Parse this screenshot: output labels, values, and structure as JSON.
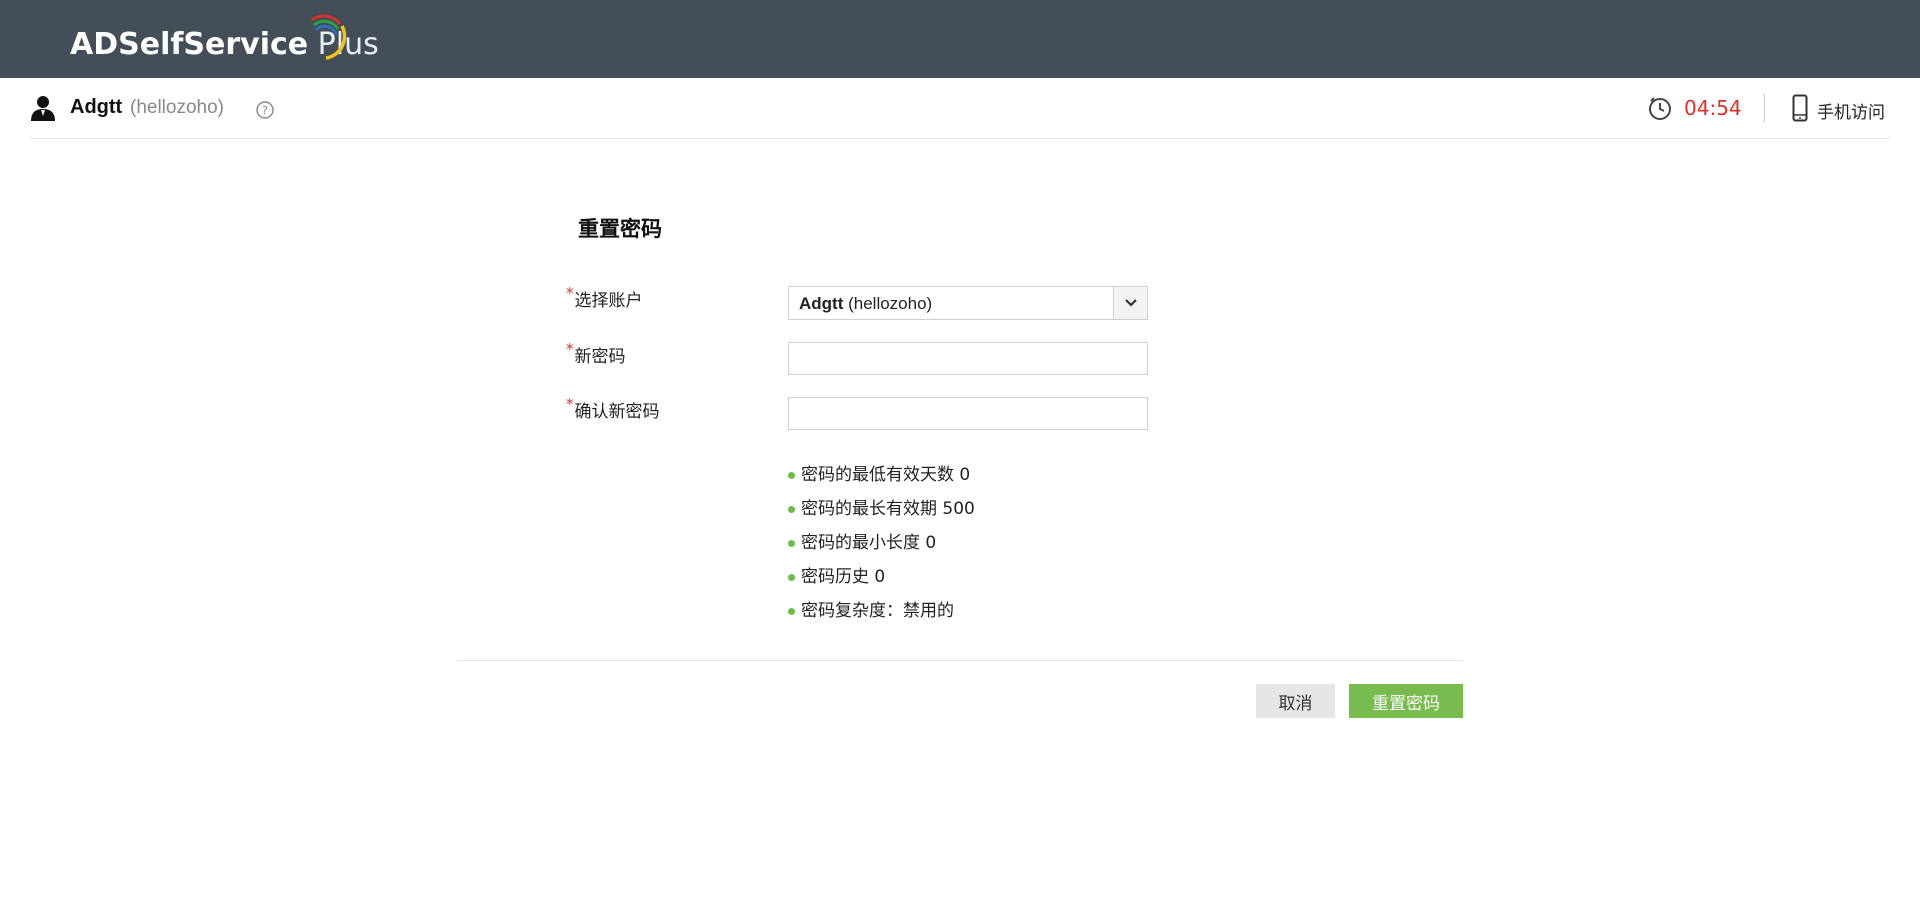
{
  "header": {
    "logo_bold": "ADSelfService",
    "logo_thin": "Plus"
  },
  "userbar": {
    "display_name": "Adgtt",
    "login_name": "(hellozoho)",
    "session_timer": "04:54",
    "mobile_access_label": "手机访问"
  },
  "form": {
    "title": "重置密码",
    "required_mark": "*",
    "fields": [
      {
        "label": "选择账户",
        "type": "select",
        "value_bold": "Adgtt",
        "value_rest": " (hellozoho)"
      },
      {
        "label": "新密码",
        "type": "password",
        "value": ""
      },
      {
        "label": "确认新密码",
        "type": "password",
        "value": ""
      }
    ],
    "policy": [
      "密码的最低有效天数 0",
      "密码的最长有效期 500",
      "密码的最小长度 0",
      "密码历史 0",
      "密码复杂度：禁用的"
    ],
    "buttons": {
      "cancel": "取消",
      "submit": "重置密码"
    }
  },
  "colors": {
    "header_bg": "#434e58",
    "timer": "#e0302a",
    "required": "#e0302a",
    "policy_dot": "#6dbb48",
    "submit_bg": "#78bb4e",
    "cancel_bg": "#e6e6e6"
  },
  "icons": {
    "user": "user-icon",
    "help": "help-icon",
    "timer": "clock-icon",
    "mobile": "mobile-phone-icon",
    "dropdown": "chevron-down-icon"
  }
}
